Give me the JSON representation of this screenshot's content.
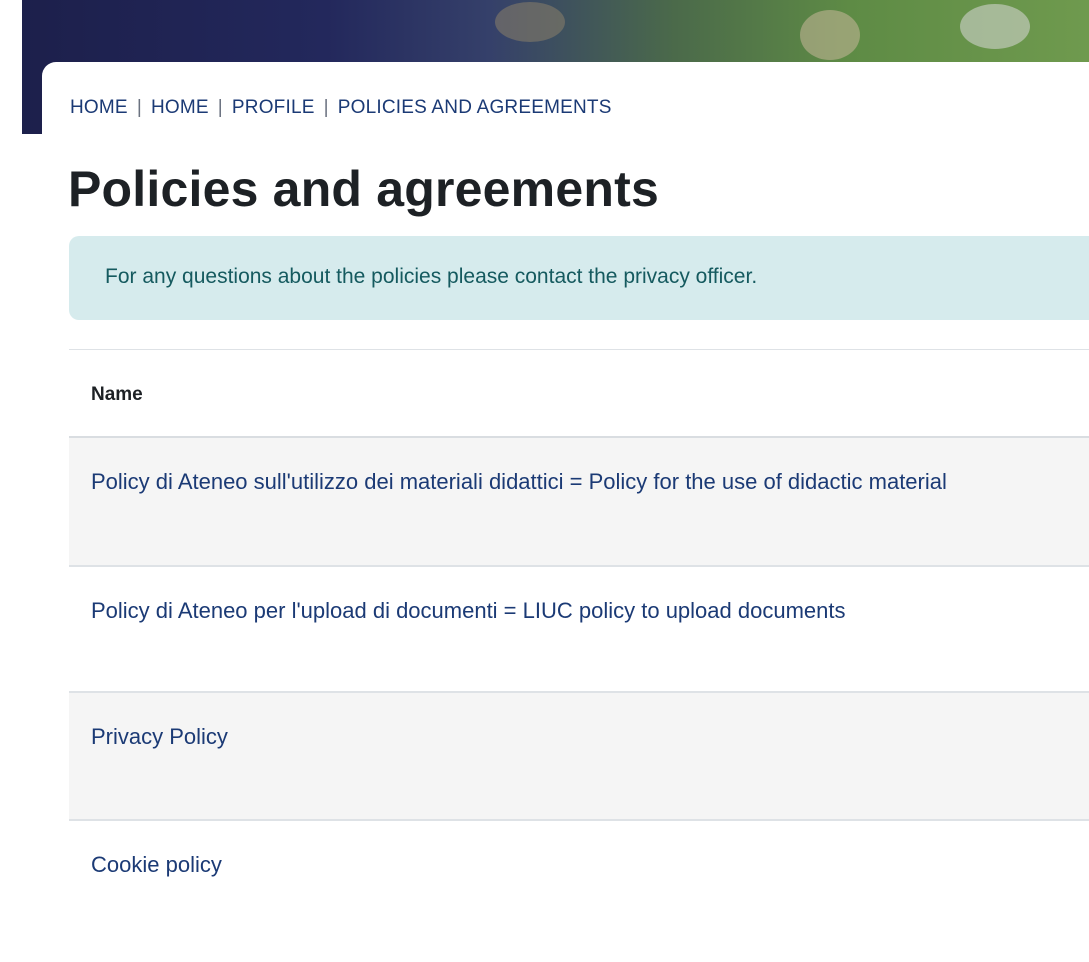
{
  "breadcrumb": {
    "items": [
      "HOME",
      "HOME",
      "PROFILE",
      "POLICIES AND AGREEMENTS"
    ],
    "separator": "|"
  },
  "page": {
    "title": "Policies and agreements"
  },
  "alert": {
    "text": "For any questions about the policies please contact the privacy officer."
  },
  "table": {
    "header_name": "Name",
    "rows": [
      "Policy di Ateneo sull'utilizzo dei materiali didattici = Policy for the use of didactic material",
      "Policy di Ateneo per l'upload di documenti = LIUC policy to upload documents",
      "Privacy Policy",
      "Cookie policy"
    ]
  },
  "colors": {
    "link": "#1b3a75",
    "alert_bg": "#d6ebed",
    "alert_text": "#155a5f",
    "row_stripe": "#f5f5f5"
  }
}
